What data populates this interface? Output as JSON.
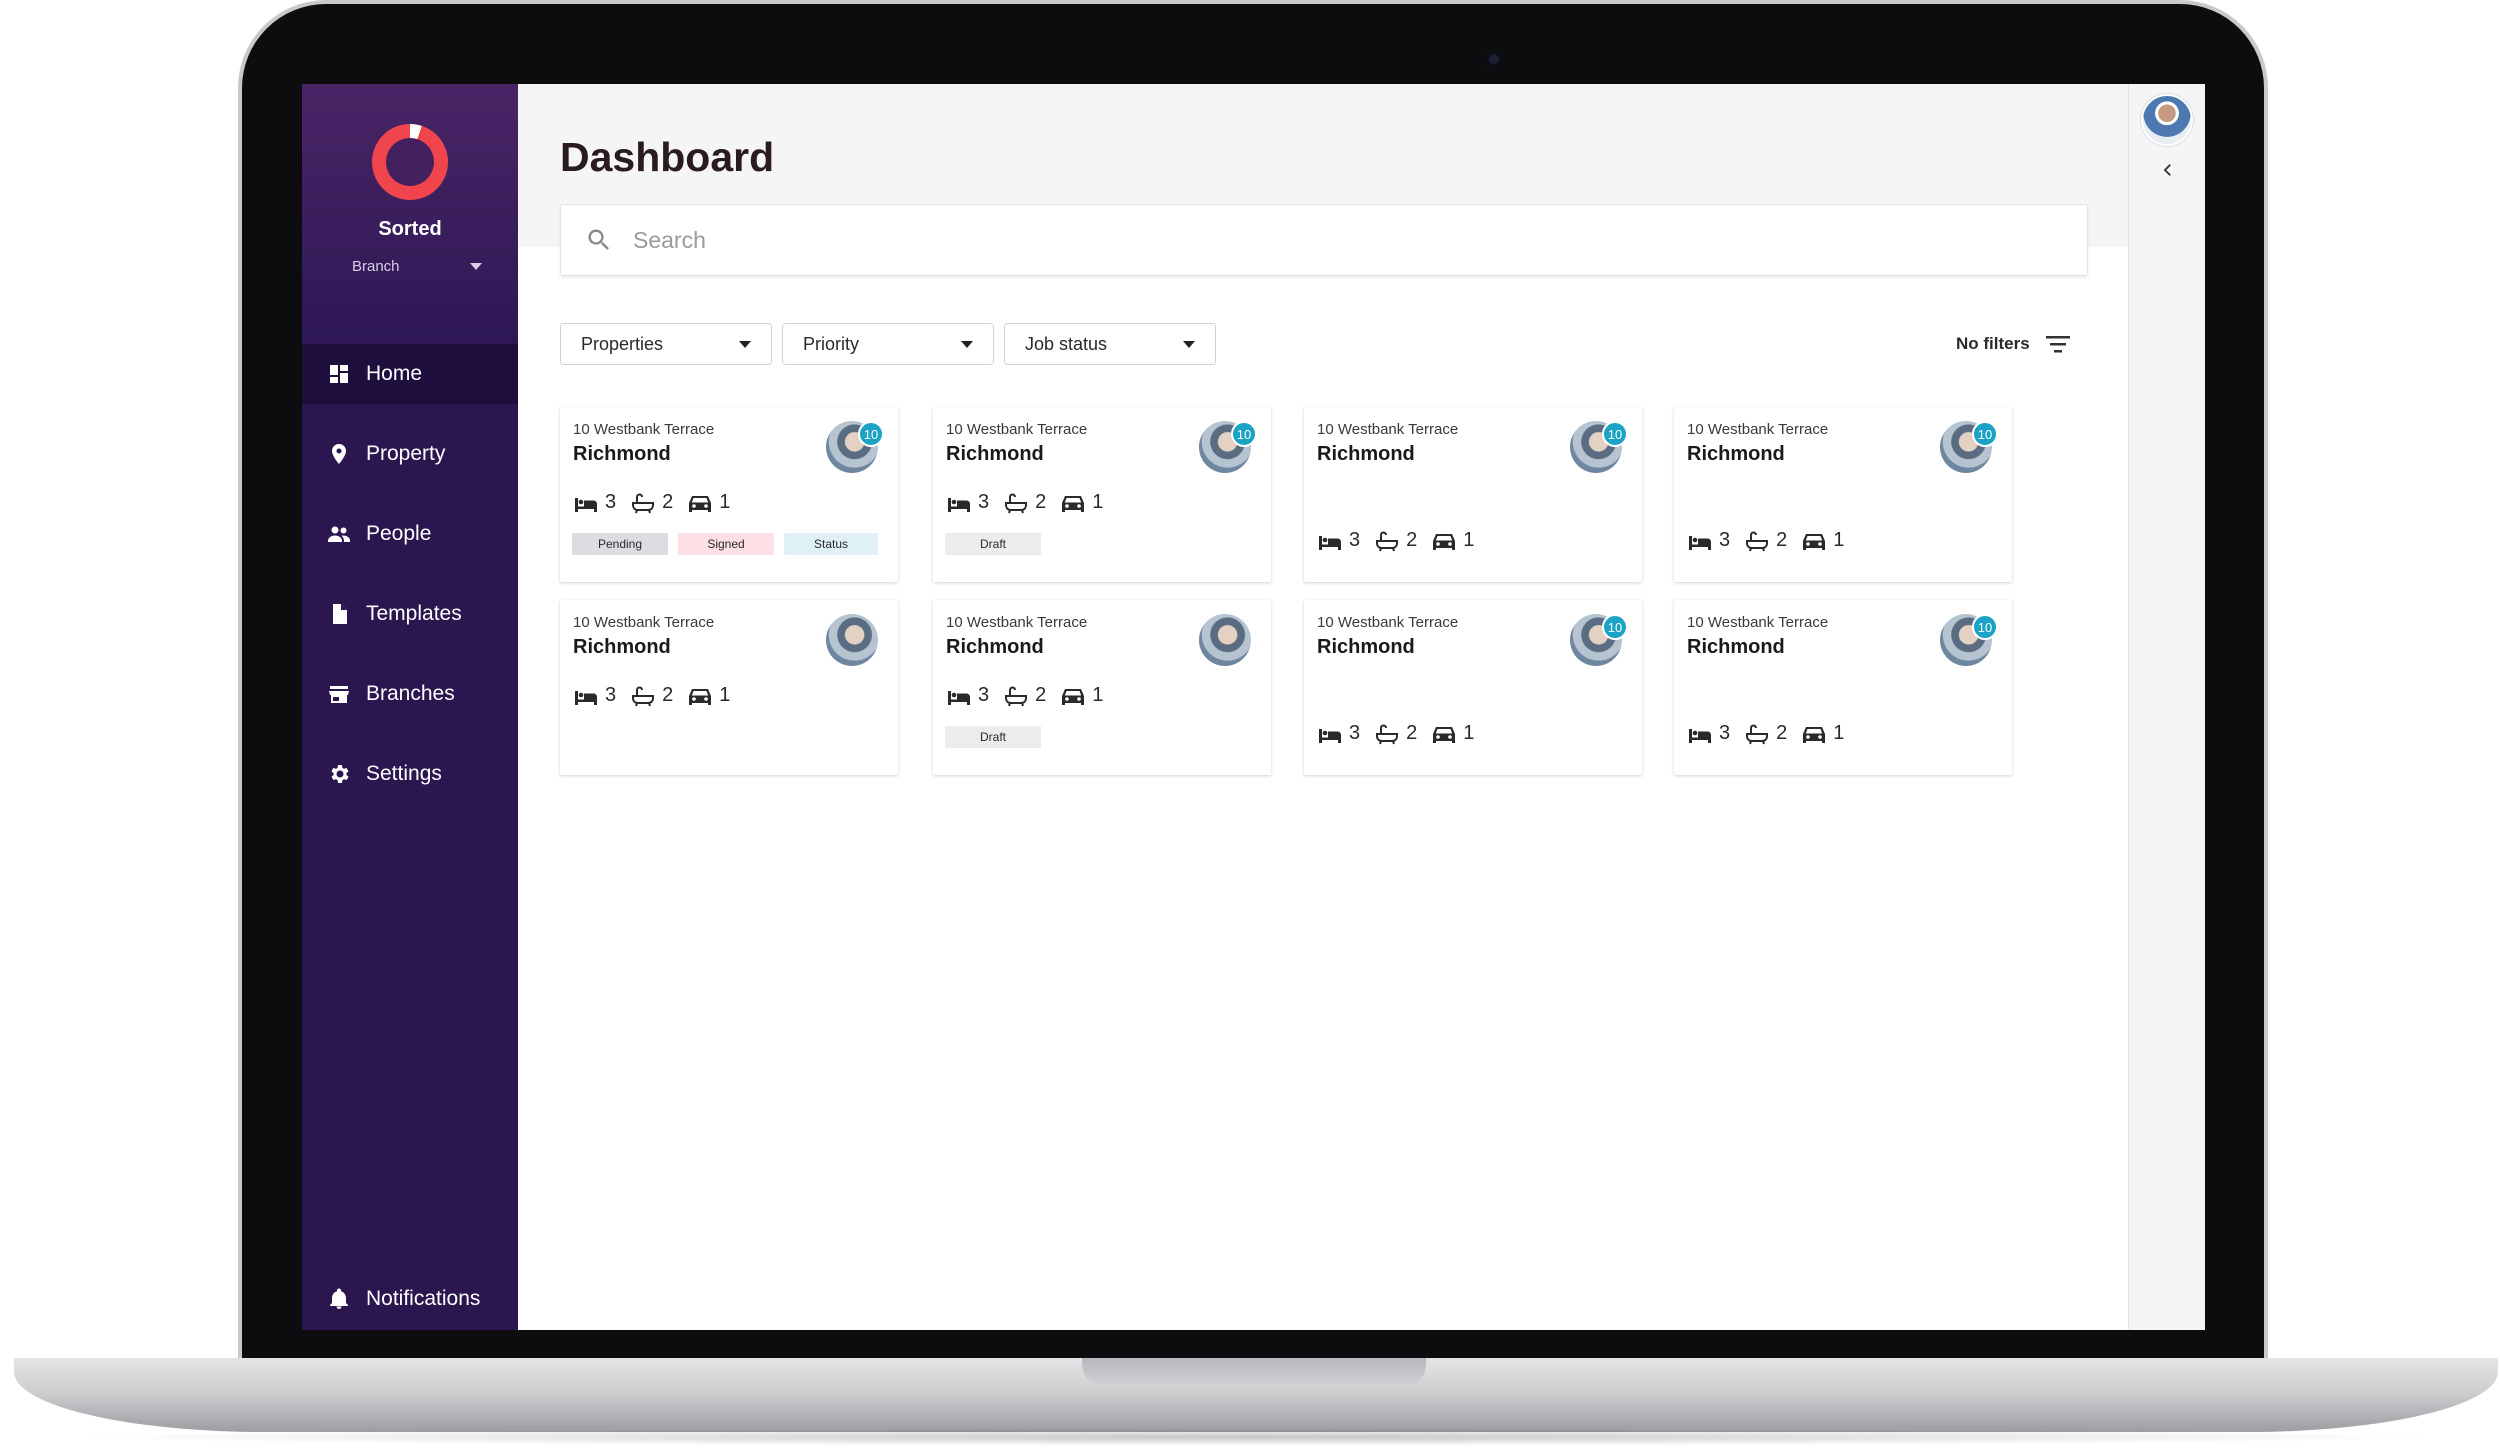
{
  "app": {
    "brand": "Sorted",
    "branch_label": "Branch"
  },
  "nav": {
    "items": [
      {
        "label": "Home",
        "icon": "dashboard-icon",
        "active": true
      },
      {
        "label": "Property",
        "icon": "location-pin-icon"
      },
      {
        "label": "People",
        "icon": "people-icon"
      },
      {
        "label": "Templates",
        "icon": "document-icon"
      },
      {
        "label": "Branches",
        "icon": "store-icon"
      },
      {
        "label": "Settings",
        "icon": "gear-icon"
      }
    ],
    "notifications": "Notifications"
  },
  "page": {
    "title": "Dashboard",
    "search_placeholder": "Search"
  },
  "filters": {
    "properties": "Properties",
    "priority": "Priority",
    "job_status": "Job status",
    "no_filters": "No filters"
  },
  "cards": [
    {
      "address": "10 Westbank Terrace",
      "city": "Richmond",
      "badge": "10",
      "beds": "3",
      "baths": "2",
      "parking": "1",
      "tags": [
        "Pending",
        "Signed",
        "Status"
      ]
    },
    {
      "address": "10 Westbank Terrace",
      "city": "Richmond",
      "badge": "10",
      "beds": "3",
      "baths": "2",
      "parking": "1",
      "tags": [
        "Draft"
      ]
    },
    {
      "address": "10 Westbank Terrace",
      "city": "Richmond",
      "badge": "10",
      "beds": "3",
      "baths": "2",
      "parking": "1",
      "tags": []
    },
    {
      "address": "10 Westbank Terrace",
      "city": "Richmond",
      "badge": "10",
      "beds": "3",
      "baths": "2",
      "parking": "1",
      "tags": []
    },
    {
      "address": "10 Westbank Terrace",
      "city": "Richmond",
      "badge": "",
      "beds": "3",
      "baths": "2",
      "parking": "1",
      "tags": []
    },
    {
      "address": "10 Westbank Terrace",
      "city": "Richmond",
      "badge": "",
      "beds": "3",
      "baths": "2",
      "parking": "1",
      "tags": [
        "Draft"
      ]
    },
    {
      "address": "10 Westbank Terrace",
      "city": "Richmond",
      "badge": "10",
      "beds": "3",
      "baths": "2",
      "parking": "1",
      "tags": []
    },
    {
      "address": "10 Westbank Terrace",
      "city": "Richmond",
      "badge": "10",
      "beds": "3",
      "baths": "2",
      "parking": "1",
      "tags": []
    }
  ],
  "colors": {
    "sidebar": "#2b1650",
    "accent": "#f0454d",
    "badge": "#1ba3c6",
    "tag_pending": "#dedbe2",
    "tag_signed": "#fde0e4",
    "tag_status": "#dff1f6",
    "tag_draft": "#ececec"
  }
}
